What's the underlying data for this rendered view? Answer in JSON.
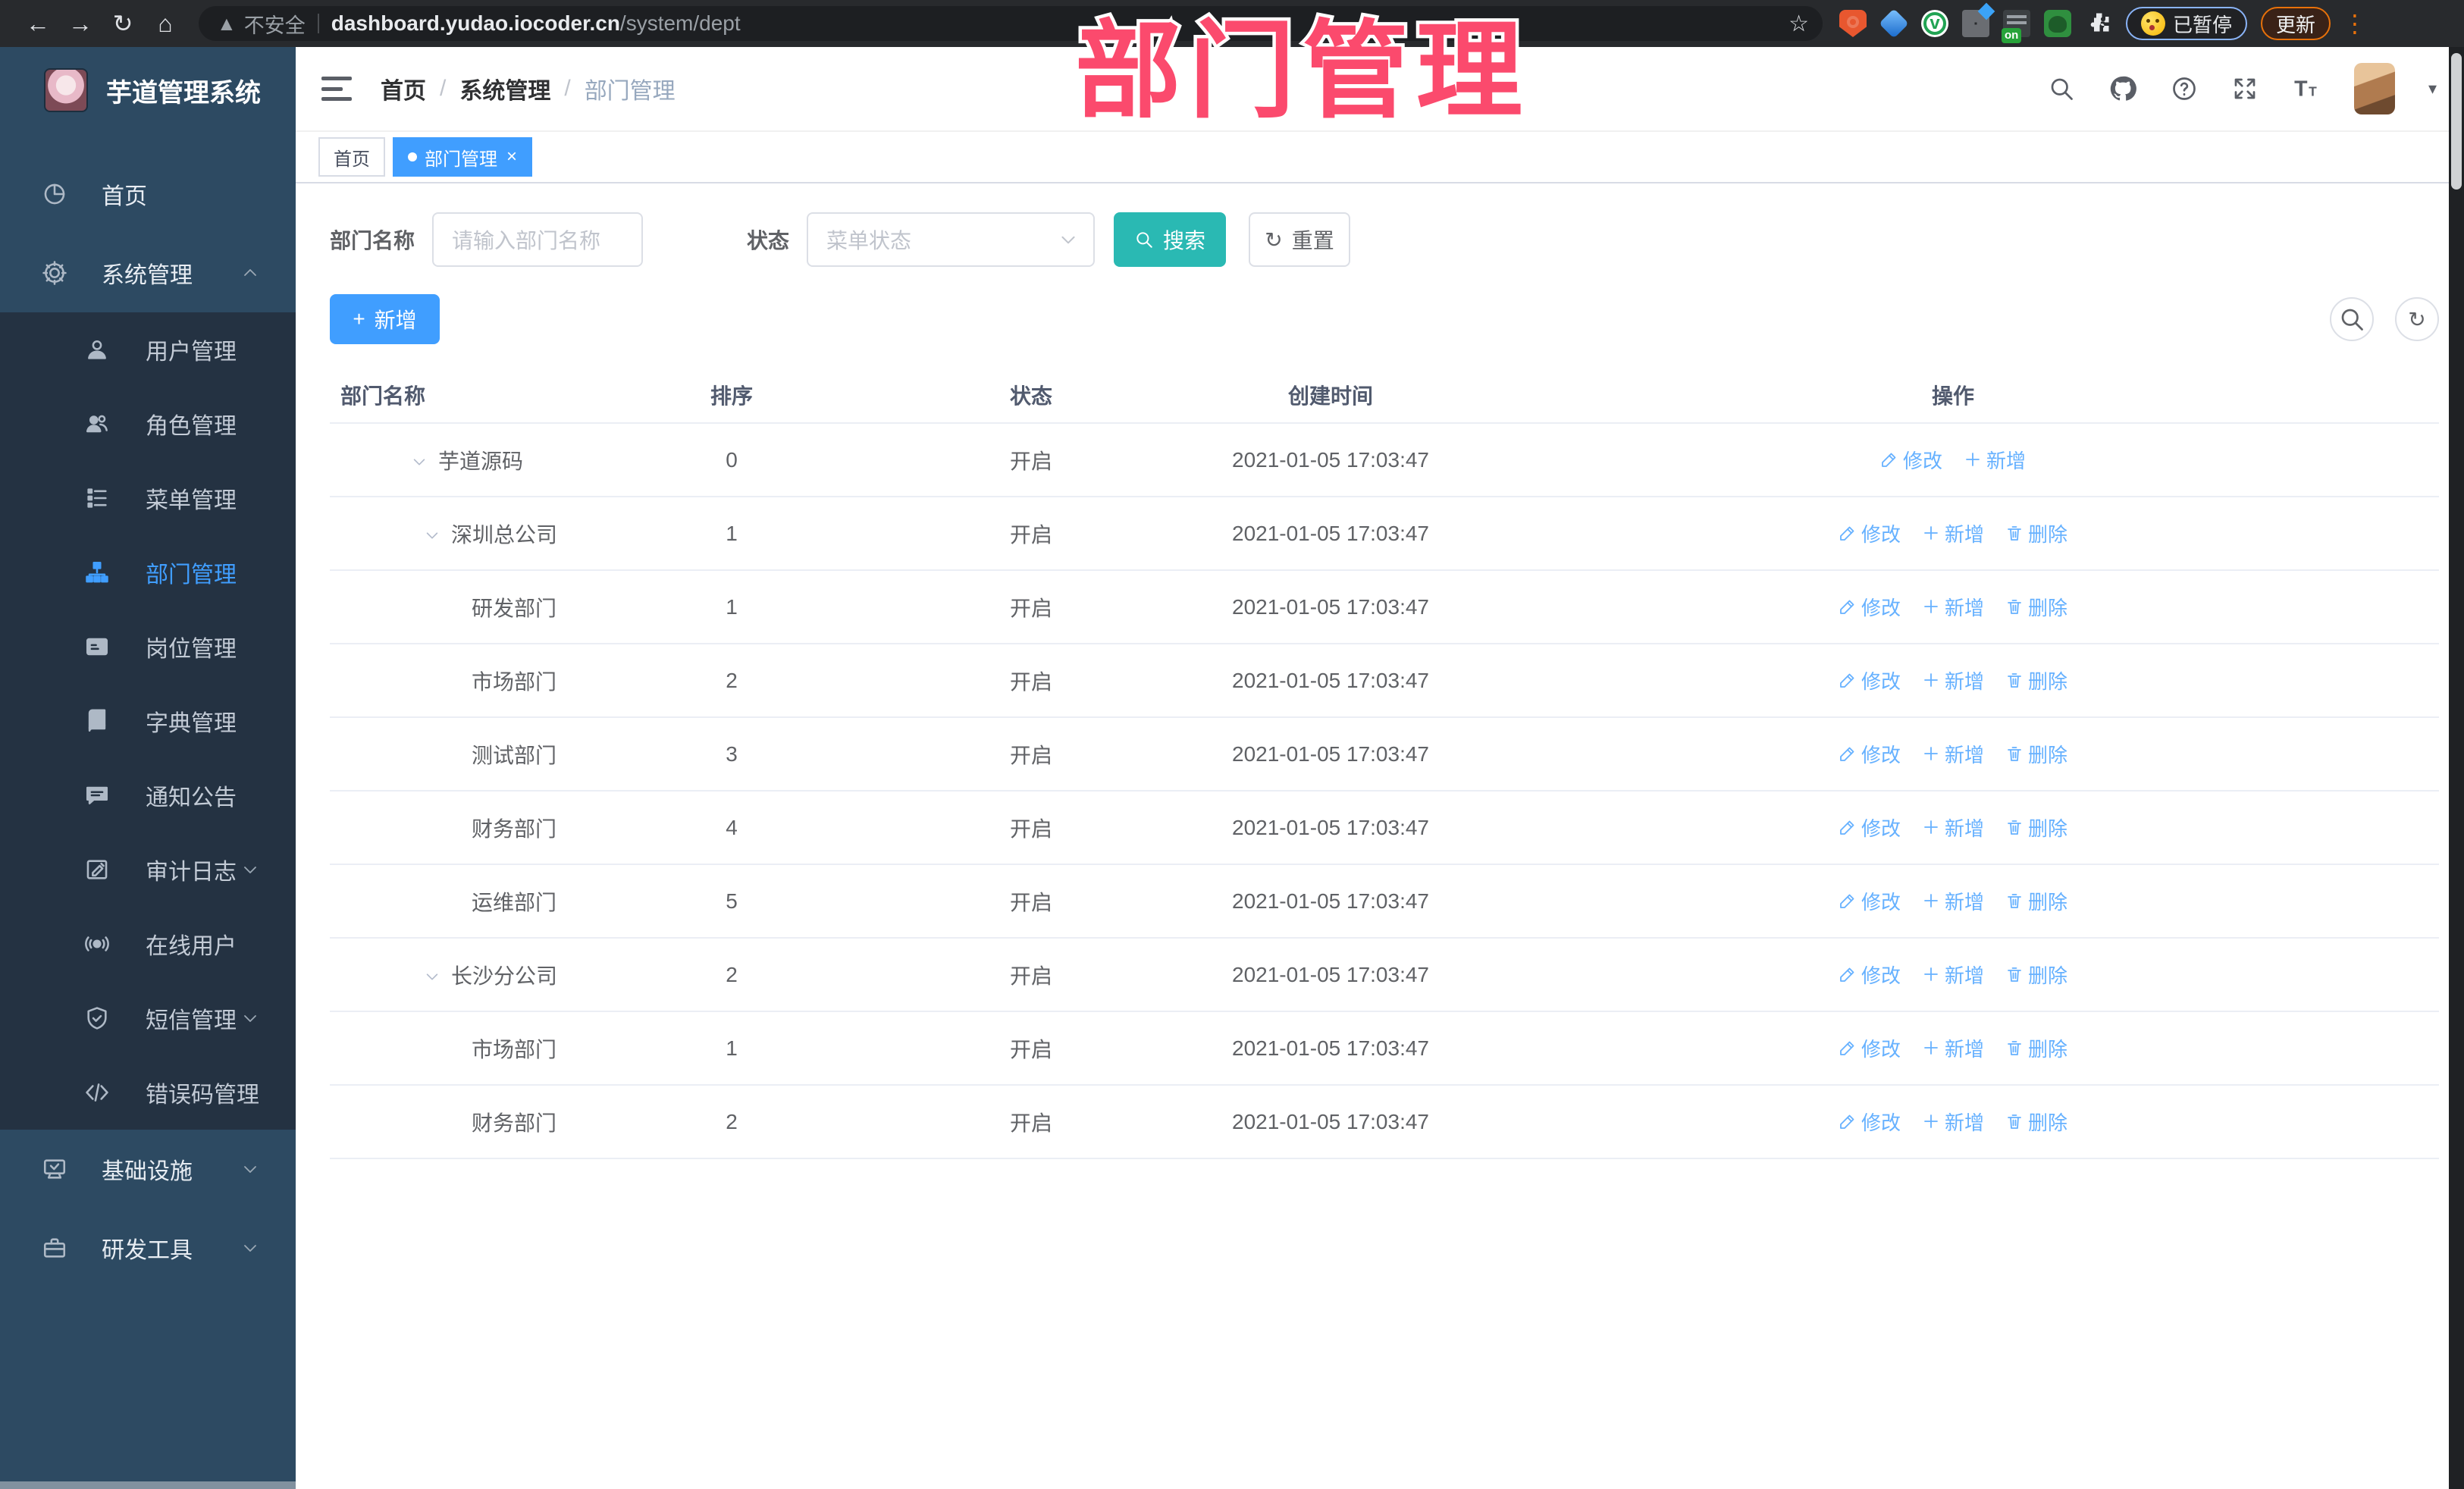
{
  "browser": {
    "security_label": "不安全",
    "url_domain": "dashboard.yudao.iocoder.cn",
    "url_path": "/system/dept",
    "profile_chip_label": "已暂停",
    "update_button_label": "更新"
  },
  "watermark_text": "部门管理",
  "sidebar": {
    "title": "芋道管理系统",
    "menu": [
      {
        "label": "首页",
        "icon": "dashboard-icon",
        "type": "root"
      },
      {
        "label": "系统管理",
        "icon": "gear-icon",
        "type": "root",
        "chevron": "up"
      },
      {
        "label": "用户管理",
        "icon": "user-icon",
        "type": "sub"
      },
      {
        "label": "角色管理",
        "icon": "users-icon",
        "type": "sub"
      },
      {
        "label": "菜单管理",
        "icon": "menu-list-icon",
        "type": "sub"
      },
      {
        "label": "部门管理",
        "icon": "dept-tree-icon",
        "type": "sub",
        "active": true
      },
      {
        "label": "岗位管理",
        "icon": "id-card-icon",
        "type": "sub"
      },
      {
        "label": "字典管理",
        "icon": "dict-book-icon",
        "type": "sub"
      },
      {
        "label": "通知公告",
        "icon": "announcement-icon",
        "type": "sub"
      },
      {
        "label": "审计日志",
        "icon": "audit-log-icon",
        "type": "sub",
        "chevron": "down"
      },
      {
        "label": "在线用户",
        "icon": "online-user-icon",
        "type": "sub"
      },
      {
        "label": "短信管理",
        "icon": "sms-icon",
        "type": "sub",
        "chevron": "down"
      },
      {
        "label": "错误码管理",
        "icon": "error-code-icon",
        "type": "sub"
      },
      {
        "label": "基础设施",
        "icon": "infrastructure-icon",
        "type": "root",
        "chevron": "down"
      },
      {
        "label": "研发工具",
        "icon": "dev-tools-icon",
        "type": "root",
        "chevron": "down"
      }
    ]
  },
  "header": {
    "breadcrumb": [
      "首页",
      "系统管理",
      "部门管理"
    ]
  },
  "tabs": [
    {
      "label": "首页",
      "active": false
    },
    {
      "label": "部门管理",
      "active": true,
      "closable": true
    }
  ],
  "filter": {
    "name_label": "部门名称",
    "name_placeholder": "请输入部门名称",
    "status_label": "状态",
    "status_placeholder": "菜单状态",
    "search_label": "搜索",
    "reset_label": "重置"
  },
  "toolbar": {
    "add_label": "新增"
  },
  "table": {
    "columns": [
      "部门名称",
      "排序",
      "状态",
      "创建时间",
      "操作"
    ],
    "action_labels": {
      "edit": "修改",
      "add": "新增",
      "delete": "删除"
    },
    "rows": [
      {
        "name": "芋道源码",
        "level": 0,
        "expandable": true,
        "sort": "0",
        "status": "开启",
        "time": "2021-01-05 17:03:47",
        "actions": [
          "edit",
          "add"
        ]
      },
      {
        "name": "深圳总公司",
        "level": 1,
        "expandable": true,
        "sort": "1",
        "status": "开启",
        "time": "2021-01-05 17:03:47",
        "actions": [
          "edit",
          "add",
          "delete"
        ]
      },
      {
        "name": "研发部门",
        "level": 2,
        "expandable": false,
        "sort": "1",
        "status": "开启",
        "time": "2021-01-05 17:03:47",
        "actions": [
          "edit",
          "add",
          "delete"
        ]
      },
      {
        "name": "市场部门",
        "level": 2,
        "expandable": false,
        "sort": "2",
        "status": "开启",
        "time": "2021-01-05 17:03:47",
        "actions": [
          "edit",
          "add",
          "delete"
        ]
      },
      {
        "name": "测试部门",
        "level": 2,
        "expandable": false,
        "sort": "3",
        "status": "开启",
        "time": "2021-01-05 17:03:47",
        "actions": [
          "edit",
          "add",
          "delete"
        ]
      },
      {
        "name": "财务部门",
        "level": 2,
        "expandable": false,
        "sort": "4",
        "status": "开启",
        "time": "2021-01-05 17:03:47",
        "actions": [
          "edit",
          "add",
          "delete"
        ]
      },
      {
        "name": "运维部门",
        "level": 2,
        "expandable": false,
        "sort": "5",
        "status": "开启",
        "time": "2021-01-05 17:03:47",
        "actions": [
          "edit",
          "add",
          "delete"
        ]
      },
      {
        "name": "长沙分公司",
        "level": 1,
        "expandable": true,
        "sort": "2",
        "status": "开启",
        "time": "2021-01-05 17:03:47",
        "actions": [
          "edit",
          "add",
          "delete"
        ]
      },
      {
        "name": "市场部门",
        "level": 2,
        "expandable": false,
        "sort": "1",
        "status": "开启",
        "time": "2021-01-05 17:03:47",
        "actions": [
          "edit",
          "add",
          "delete"
        ]
      },
      {
        "name": "财务部门",
        "level": 2,
        "expandable": false,
        "sort": "2",
        "status": "开启",
        "time": "2021-01-05 17:03:47",
        "actions": [
          "edit",
          "add",
          "delete"
        ]
      }
    ]
  },
  "colors": {
    "primary_blue": "#409eff",
    "search_teal": "#2ab9b3",
    "row_link_blue": "#66b1ff",
    "watermark_pink": "#fb4a6d",
    "sidebar_bg": "#2d4a62",
    "submenu_bg": "#243242"
  }
}
